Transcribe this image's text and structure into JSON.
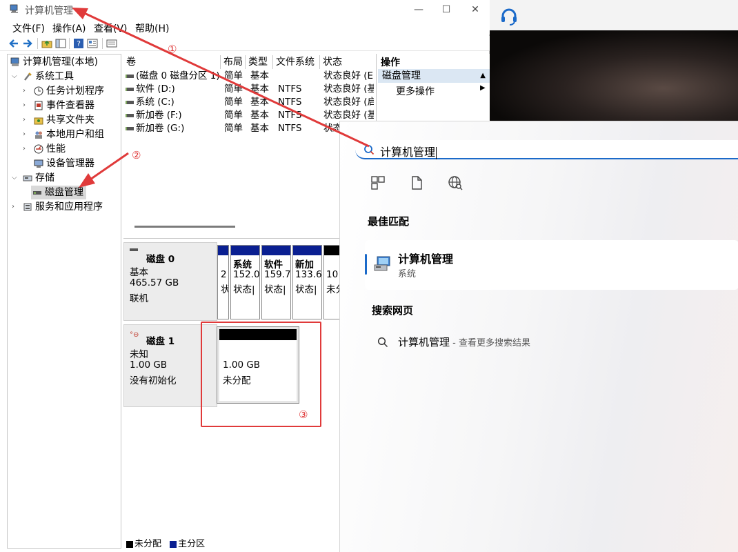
{
  "window": {
    "title": "计算机管理",
    "minimize": "—",
    "maximize": "☐",
    "close": "✕"
  },
  "menu": {
    "file": "文件(F)",
    "action": "操作(A)",
    "view": "查看(V)",
    "help": "帮助(H)"
  },
  "tree": {
    "root": "计算机管理(本地)",
    "system_tools": "系统工具",
    "task_scheduler": "任务计划程序",
    "event_viewer": "事件查看器",
    "shared_folders": "共享文件夹",
    "local_users": "本地用户和组",
    "performance": "性能",
    "device_manager": "设备管理器",
    "storage": "存储",
    "disk_management": "磁盘管理",
    "services_apps": "服务和应用程序"
  },
  "volume_list": {
    "headers": [
      "卷",
      "布局",
      "类型",
      "文件系统",
      "状态"
    ],
    "rows": [
      [
        "(磁盘 0 磁盘分区 1)",
        "简单",
        "基本",
        "",
        "状态良好 (E"
      ],
      [
        "软件 (D:)",
        "简单",
        "基本",
        "NTFS",
        "状态良好 (基"
      ],
      [
        "系统 (C:)",
        "简单",
        "基本",
        "NTFS",
        "状态良好 (启"
      ],
      [
        "新加卷 (F:)",
        "简单",
        "基本",
        "NTFS",
        "状态良好 (基"
      ],
      [
        "新加卷 (G:)",
        "简单",
        "基本",
        "NTFS",
        "状态"
      ]
    ]
  },
  "actions": {
    "title": "操作",
    "section": "磁盘管理",
    "more": "更多操作"
  },
  "disks": [
    {
      "name": "磁盘 0",
      "type": "基本",
      "size": "465.57 GB",
      "status": "联机",
      "partitions": [
        {
          "line1": "",
          "line2": "2",
          "line3": "状"
        },
        {
          "line1": "系统",
          "line2": "152.0",
          "line3": "状态|"
        },
        {
          "line1": "软件",
          "line2": "159.7",
          "line3": "状态|"
        },
        {
          "line1": "新加",
          "line2": "133.6",
          "line3": "状态|"
        },
        {
          "line1": "",
          "line2": "10",
          "line3": "未分"
        }
      ]
    },
    {
      "name": "磁盘 1",
      "type": "未知",
      "size": "1.00 GB",
      "status": "没有初始化",
      "unallocated": {
        "size": "1.00 GB",
        "label": "未分配"
      }
    }
  ],
  "legend": {
    "unallocated": "未分配",
    "primary": "主分区",
    "colors": {
      "unallocated": "#000000",
      "primary": "#0a1f91"
    }
  },
  "annotations": {
    "step1": "①",
    "step2": "②",
    "step3": "③"
  },
  "search": {
    "query": "计算机管理",
    "best_match_title": "最佳匹配",
    "best_match_name": "计算机管理",
    "best_match_type": "系统",
    "web_title": "搜索网页",
    "web_query": "计算机管理",
    "web_hint": " - 查看更多搜索结果"
  },
  "colors": {
    "accent": "#1b6ac9",
    "annotation": "#e03a3a",
    "selection": "#d9d9d9"
  }
}
